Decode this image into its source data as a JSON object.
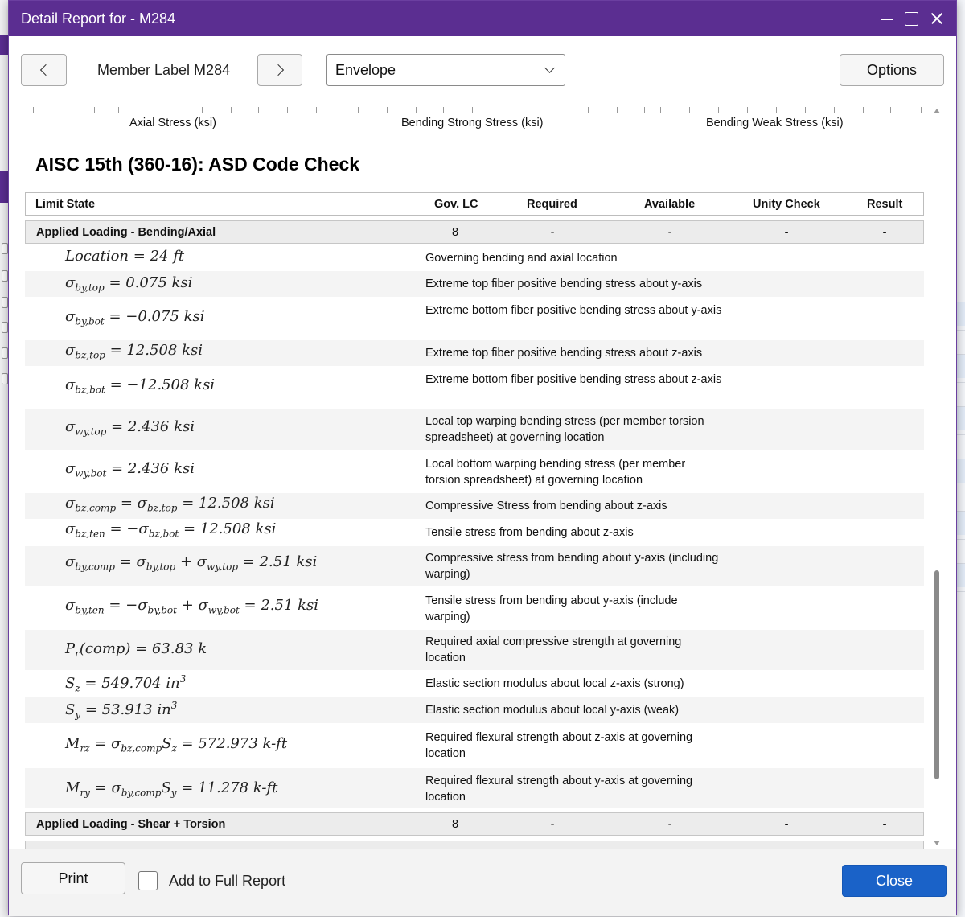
{
  "dialog": {
    "title": "Detail Report for - M284"
  },
  "toolbar": {
    "member_label": "Member Label M284",
    "select_value": "Envelope",
    "options_label": "Options"
  },
  "axis_labels": [
    "Axial Stress (ksi)",
    "Bending Strong Stress (ksi)",
    "Bending Weak Stress (ksi)"
  ],
  "section_title": "AISC 15th (360-16): ASD Code Check",
  "table": {
    "headers": {
      "limit_state": "Limit State",
      "gov_lc": "Gov. LC",
      "required": "Required",
      "available": "Available",
      "unity": "Unity Check",
      "result": "Result"
    },
    "group1": {
      "label": "Applied Loading - Bending/Axial",
      "gov_lc": "8",
      "required": "-",
      "available": "-",
      "unity": "-",
      "result": "-"
    },
    "rows": [
      {
        "desc": "Governing bending and axial location"
      },
      {
        "desc": "Extreme top fiber positive bending stress about y-axis"
      },
      {
        "desc": "Extreme bottom fiber positive bending stress about y-axis"
      },
      {
        "desc": "Extreme top fiber positive bending stress about z-axis"
      },
      {
        "desc": "Extreme bottom fiber positive bending stress about z-axis"
      },
      {
        "desc": "Local top warping bending stress (per member torsion spreadsheet) at governing location"
      },
      {
        "desc": "Local bottom warping bending stress (per member torsion spreadsheet) at governing location"
      },
      {
        "desc": "Compressive Stress from bending about z-axis"
      },
      {
        "desc": "Tensile stress from bending about z-axis"
      },
      {
        "desc": "Compressive stress from bending about y-axis (including warping)"
      },
      {
        "desc": "Tensile stress from bending about y-axis (include warping)"
      },
      {
        "desc": "Required axial compressive strength at governing location"
      },
      {
        "desc": "Elastic section modulus about local z-axis (strong)"
      },
      {
        "desc": "Elastic section modulus about local y-axis (weak)"
      },
      {
        "desc": "Required flexural strength about z-axis at governing location"
      },
      {
        "desc": "Required flexural strength about y-axis at governing location"
      }
    ],
    "group2": {
      "label": "Applied Loading - Shear + Torsion",
      "gov_lc": "8",
      "required": "-",
      "available": "-",
      "unity": "-",
      "result": "-"
    }
  },
  "equations": {
    "e0_val": "24 ft",
    "e1_val": "0.075 ksi",
    "e2_val": "−0.075 ksi",
    "e3_val": "12.508 ksi",
    "e4_val": "−12.508 ksi",
    "e5_val": "2.436 ksi",
    "e6_val": "2.436 ksi",
    "e7_val": "12.508 ksi",
    "e8_val": "12.508 ksi",
    "e9_val": "2.51 ksi",
    "e10_val": "2.51 ksi",
    "e11_val": "63.83 k",
    "e12_val": "549.704 in",
    "e13_val": "53.913 in",
    "e14_val": "572.973 k-ft",
    "e15_val": "11.278 k-ft"
  },
  "footer": {
    "print_label": "Print",
    "add_label": "Add to Full Report",
    "close_label": "Close",
    "add_checked": false
  }
}
